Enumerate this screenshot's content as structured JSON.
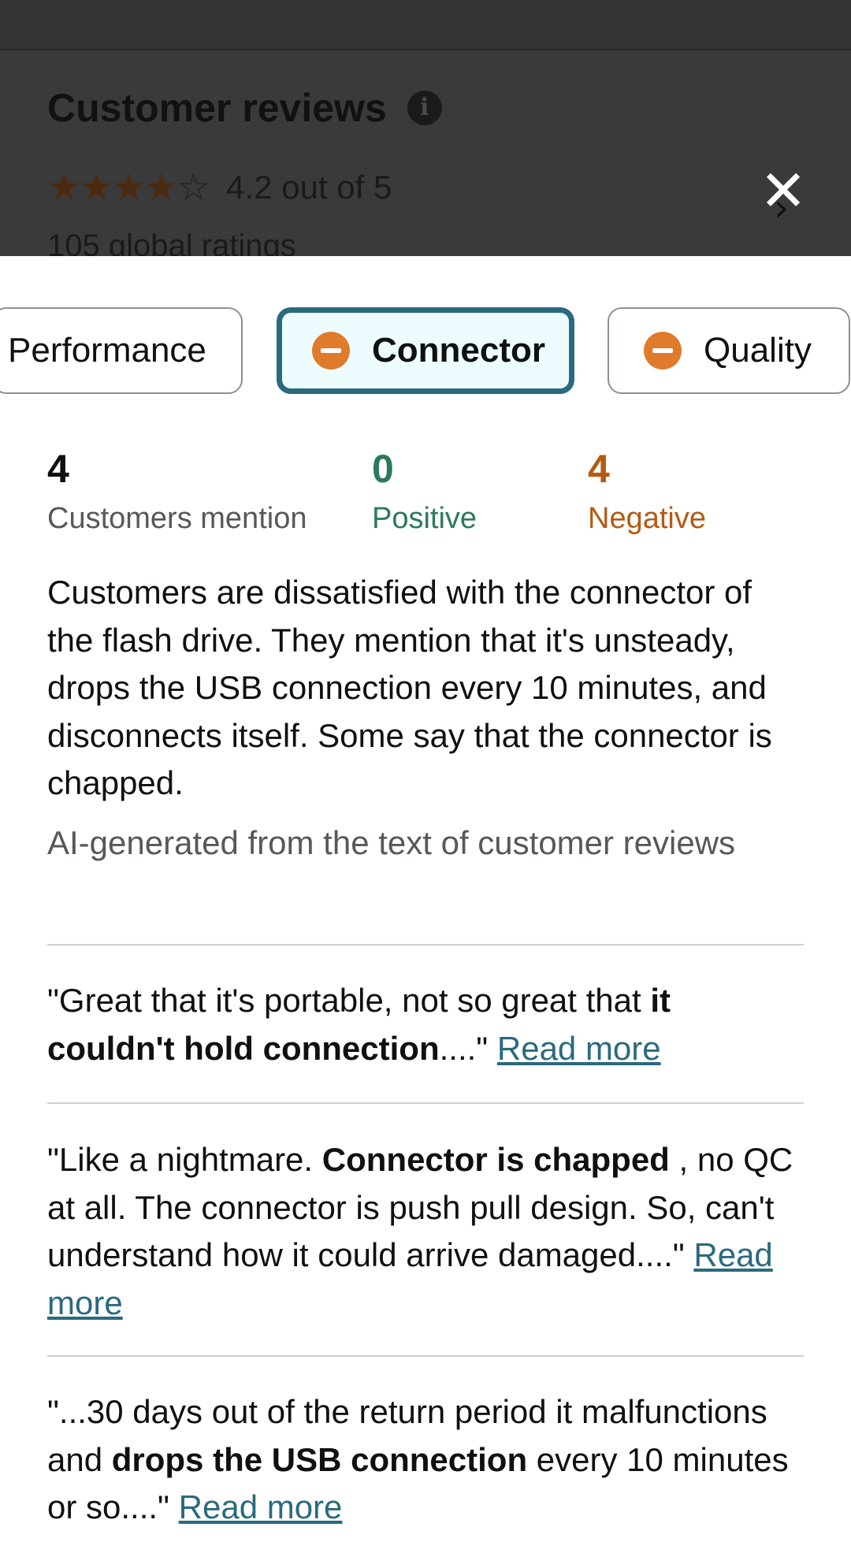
{
  "background": {
    "title": "Customer reviews",
    "rating_text": "4.2 out of 5",
    "global_ratings": "105 global ratings",
    "stars_filled": 4,
    "stars_total": 5
  },
  "close_label": "✕",
  "chips": [
    {
      "label": "Performance",
      "selected": false,
      "sentiment": "none"
    },
    {
      "label": "Connector",
      "selected": true,
      "sentiment": "negative"
    },
    {
      "label": "Quality",
      "selected": false,
      "sentiment": "negative"
    }
  ],
  "stats": {
    "mention_count": "4",
    "mention_label": "Customers mention",
    "positive_count": "0",
    "positive_label": "Positive",
    "negative_count": "4",
    "negative_label": "Negative"
  },
  "summary": "Customers are dissatisfied with the connector of the flash drive. They mention that it's unsteady, drops the USB connection every 10 minutes, and disconnects itself. Some say that the connector is chapped.",
  "ai_note": "AI-generated from the text of customer reviews",
  "read_more_label": "Read more",
  "quotes": [
    {
      "before": "\"Great that it's portable, not so great that ",
      "bold": "it couldn't hold connection",
      "after": "....\" "
    },
    {
      "before": "\"Like a nightmare. ",
      "bold": "Connector is chapped",
      "after": " , no QC at all. The connector is push pull design. So, can't understand how it could arrive damaged....\" "
    },
    {
      "before": "\"...30 days out of the return period it malfunctions and ",
      "bold": "drops the USB connection",
      "after": " every 10 minutes or so....\" "
    }
  ],
  "colors": {
    "accent": "#2a6a7e",
    "negative": "#b35a13",
    "positive": "#2c7a5a",
    "minus_icon": "#e07b2c"
  }
}
